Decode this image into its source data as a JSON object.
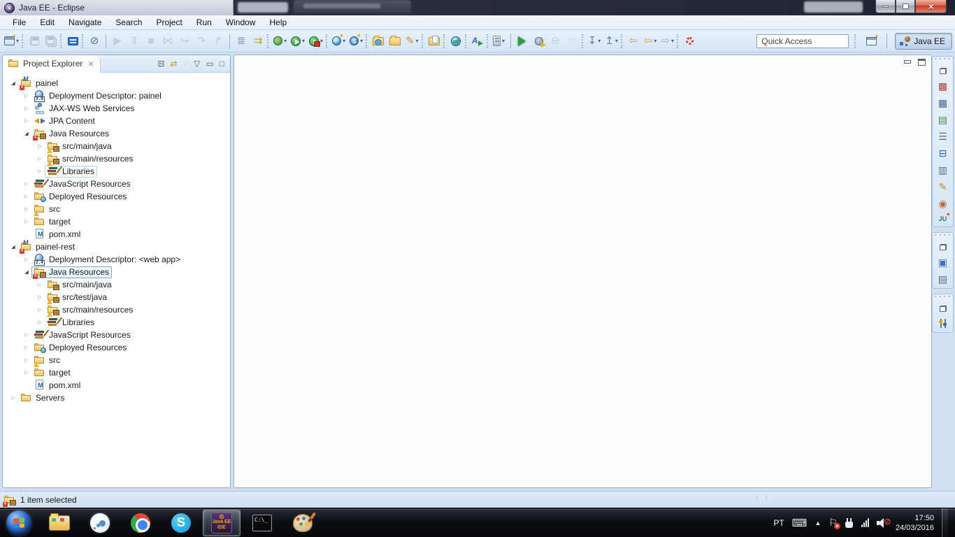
{
  "window": {
    "title": "Java EE - Eclipse",
    "controls": [
      {
        "name": "minimize-button"
      },
      {
        "name": "restore-button"
      },
      {
        "name": "close-button",
        "glyph": "×"
      }
    ]
  },
  "menu_bar": {
    "items": [
      "File",
      "Edit",
      "Navigate",
      "Search",
      "Project",
      "Run",
      "Window",
      "Help"
    ]
  },
  "toolbar": {
    "quick_access_placeholder": "Quick Access",
    "perspective_label": "Java EE",
    "open_perspective_icon": "open-perspective-icon",
    "groups": [
      {
        "sep": "none",
        "icons": [
          {
            "n": "new-wizard-icon",
            "t": "css",
            "c": "tb-new",
            "dd": true
          }
        ]
      },
      {
        "sep": "dot",
        "icons": [
          {
            "n": "save-icon",
            "t": "css",
            "c": "tb-floppy",
            "dis": true
          },
          {
            "n": "save-all-icon",
            "t": "css",
            "c": "tb-floppy tb-floppy-all",
            "dis": true
          }
        ]
      },
      {
        "sep": "dot",
        "icons": [
          {
            "n": "open-console-icon",
            "t": "css",
            "c": "tb-console"
          }
        ]
      },
      {
        "sep": "dot",
        "icons": [
          {
            "n": "skip-all-breakpoints-icon",
            "t": "g",
            "g": "⊘",
            "col": "#4a6fa0"
          }
        ]
      },
      {
        "sep": "bar",
        "icons": [
          {
            "n": "resume-icon",
            "t": "g",
            "g": "▶",
            "col": "#a4b2c2",
            "dis": true
          },
          {
            "n": "suspend-icon",
            "t": "g",
            "g": "Ⅱ",
            "col": "#a4b2c2",
            "dis": true
          },
          {
            "n": "terminate-icon",
            "t": "g",
            "g": "■",
            "col": "#a4b2c2",
            "dis": true
          },
          {
            "n": "disconnect-icon",
            "t": "g",
            "g": "⋈",
            "col": "#a4b2c2",
            "dis": true
          },
          {
            "n": "step-into-icon",
            "t": "g",
            "g": "↪",
            "col": "#a4b2c2",
            "dis": true
          },
          {
            "n": "step-over-icon",
            "t": "g",
            "g": "↷",
            "col": "#a4b2c2",
            "dis": true
          },
          {
            "n": "step-return-icon",
            "t": "g",
            "g": "↱",
            "col": "#a4b2c2",
            "dis": true
          }
        ]
      },
      {
        "sep": "bar",
        "icons": [
          {
            "n": "run-history-icon",
            "t": "g",
            "g": "≣",
            "col": "#8a97a8"
          },
          {
            "n": "use-step-filters-icon",
            "t": "g",
            "g": "⇉",
            "col": "#d0a030"
          }
        ]
      },
      {
        "sep": "dot",
        "icons": [
          {
            "n": "debug-icon",
            "t": "css",
            "c": "tb-bug",
            "dd": true
          },
          {
            "n": "run-icon",
            "t": "css",
            "c": "tb-run",
            "dd": true
          },
          {
            "n": "run-coverage-icon",
            "t": "css",
            "c": "tb-run tb-runc",
            "dd": true
          }
        ]
      },
      {
        "sep": "dot",
        "icons": [
          {
            "n": "new-web-service-icon",
            "t": "css",
            "c": "tb-wsglobe",
            "dd": true
          },
          {
            "n": "new-web-service-client-icon",
            "t": "css",
            "c": "tb-sglobe",
            "g": "S",
            "dd": true
          }
        ]
      },
      {
        "sep": "dot",
        "icons": [
          {
            "n": "import-folder-icon",
            "t": "css",
            "c": "tb-folder-open"
          },
          {
            "n": "export-folder-icon",
            "t": "css",
            "c": "tb-folder"
          },
          {
            "n": "highlighter-pen-icon",
            "t": "g",
            "g": "✎",
            "col": "#d08a2a",
            "dd": true
          }
        ]
      },
      {
        "sep": "dot",
        "icons": [
          {
            "n": "deploy-folder-icon",
            "t": "css",
            "c": "tb-folder-page"
          }
        ]
      },
      {
        "sep": "dot",
        "icons": [
          {
            "n": "web-browser-icon",
            "t": "css",
            "c": "tb-globe"
          }
        ]
      },
      {
        "sep": "dot",
        "icons": [
          {
            "n": "external-tools-icon",
            "t": "css",
            "c": "tb-ext"
          }
        ]
      },
      {
        "sep": "dot",
        "icons": [
          {
            "n": "servers-dropdown-icon",
            "t": "css",
            "c": "tb-server",
            "dd": true
          }
        ]
      },
      {
        "sep": "bar",
        "icons": [
          {
            "n": "run-app-icon",
            "t": "css",
            "c": "tb-play"
          },
          {
            "n": "debug-config-icon",
            "t": "css",
            "c": "tb-bug2"
          },
          {
            "n": "stop-app-icon",
            "t": "g",
            "g": "⊖",
            "col": "#a4b2c2",
            "dis": true
          },
          {
            "n": "pointer-mode-icon",
            "t": "g",
            "g": "☞",
            "col": "#a4b2c2",
            "dis": true
          }
        ]
      },
      {
        "sep": "dot",
        "icons": [
          {
            "n": "next-annotation-icon",
            "t": "g",
            "g": "↧",
            "col": "#6b7f95",
            "dd": true
          },
          {
            "n": "previous-annotation-icon",
            "t": "g",
            "g": "↥",
            "col": "#6b7f95",
            "dd": true
          }
        ]
      },
      {
        "sep": "dot",
        "icons": [
          {
            "n": "last-edit-location-icon",
            "t": "g",
            "g": "⇦",
            "col": "#d0a030"
          },
          {
            "n": "back-icon",
            "t": "g",
            "g": "⇦",
            "col": "#d0a030",
            "dd": true
          },
          {
            "n": "forward-icon",
            "t": "g",
            "g": "⇨",
            "col": "#a4b2c2",
            "dd": true
          }
        ]
      },
      {
        "sep": "dot",
        "icons": [
          {
            "n": "progress-indicator-icon",
            "t": "css",
            "c": "tb-busyc"
          }
        ]
      }
    ]
  },
  "project_explorer": {
    "title": "Project Explorer",
    "tab_close_glyph": "✕",
    "tools": [
      {
        "n": "collapse-all-icon",
        "g": "⊟"
      },
      {
        "n": "link-with-editor-icon",
        "g": "⇄",
        "col": "#c9972c"
      },
      {
        "n": "focus-task-icon",
        "g": "∵",
        "col": "#b8c4d2"
      },
      {
        "n": "view-menu-icon",
        "g": "▽"
      },
      {
        "n": "minimize-view-icon",
        "g": "▭"
      },
      {
        "n": "maximize-view-icon",
        "g": "□"
      }
    ],
    "tree": [
      {
        "label": "painel",
        "depth": 0,
        "arrow": "expanded",
        "icon": "mproj",
        "badge": "error"
      },
      {
        "label": "Deployment Descriptor: painel",
        "depth": 1,
        "arrow": "collapsed",
        "icon": "dd",
        "version": "3.0"
      },
      {
        "label": "JAX-WS Web Services",
        "depth": 1,
        "arrow": "collapsed",
        "icon": "jaxws"
      },
      {
        "label": "JPA Content",
        "depth": 1,
        "arrow": "collapsed",
        "icon": "jpa"
      },
      {
        "label": "Java Resources",
        "depth": 1,
        "arrow": "expanded",
        "icon": "jres",
        "badge": "error"
      },
      {
        "label": "src/main/java",
        "depth": 2,
        "arrow": "collapsed",
        "icon": "pkg",
        "badge": "warning"
      },
      {
        "label": "src/main/resources",
        "depth": 2,
        "arrow": "collapsed",
        "icon": "pkg",
        "badge": "warning"
      },
      {
        "label": "Libraries",
        "depth": 2,
        "arrow": "collapsed",
        "icon": "books",
        "focusbox": true
      },
      {
        "label": "JavaScript Resources",
        "depth": 1,
        "arrow": "collapsed",
        "icon": "books"
      },
      {
        "label": "Deployed Resources",
        "depth": 1,
        "arrow": "collapsed",
        "icon": "dfold"
      },
      {
        "label": "src",
        "depth": 1,
        "arrow": "collapsed",
        "icon": "fold",
        "badge": "warning"
      },
      {
        "label": "target",
        "depth": 1,
        "arrow": "collapsed",
        "icon": "fold"
      },
      {
        "label": "pom.xml",
        "depth": 1,
        "arrow": "none",
        "icon": "pom"
      },
      {
        "label": "painel-rest",
        "depth": 0,
        "arrow": "expanded",
        "icon": "mproj",
        "badge": "error"
      },
      {
        "label": "Deployment Descriptor: <web app>",
        "depth": 1,
        "arrow": "collapsed",
        "icon": "dd",
        "version": "2.4"
      },
      {
        "label": "Java Resources",
        "depth": 1,
        "arrow": "expanded",
        "icon": "jres",
        "badge": "error",
        "selected": true
      },
      {
        "label": "src/main/java",
        "depth": 2,
        "arrow": "collapsed",
        "icon": "pkg"
      },
      {
        "label": "src/test/java",
        "depth": 2,
        "arrow": "collapsed",
        "icon": "pkg",
        "badge": "warning"
      },
      {
        "label": "src/main/resources",
        "depth": 2,
        "arrow": "collapsed",
        "icon": "pkg",
        "badge": "warning"
      },
      {
        "label": "Libraries",
        "depth": 2,
        "arrow": "collapsed",
        "icon": "books"
      },
      {
        "label": "JavaScript Resources",
        "depth": 1,
        "arrow": "collapsed",
        "icon": "books"
      },
      {
        "label": "Deployed Resources",
        "depth": 1,
        "arrow": "collapsed",
        "icon": "dfold"
      },
      {
        "label": "src",
        "depth": 1,
        "arrow": "collapsed",
        "icon": "fold",
        "badge": "warning"
      },
      {
        "label": "target",
        "depth": 1,
        "arrow": "collapsed",
        "icon": "fold"
      },
      {
        "label": "pom.xml",
        "depth": 1,
        "arrow": "none",
        "icon": "pom"
      },
      {
        "label": "Servers",
        "depth": 0,
        "arrow": "collapsed",
        "icon": "fold"
      }
    ]
  },
  "right_rail": {
    "groups": [
      {
        "icons": [
          {
            "n": "view-restore-icon",
            "t": "css",
            "c": "ri-restore"
          },
          {
            "n": "markers-icon",
            "t": "g",
            "g": "▩",
            "col": "#b5443c"
          },
          {
            "n": "properties-icon",
            "t": "g",
            "g": "▦",
            "col": "#44639a"
          },
          {
            "n": "palette-icon",
            "t": "g",
            "g": "▤",
            "col": "#3d8f46"
          },
          {
            "n": "outline-icon",
            "t": "g",
            "g": "☰",
            "col": "#5a6a7e"
          },
          {
            "n": "console-icon",
            "t": "g",
            "g": "⊟",
            "col": "#2e62b8"
          },
          {
            "n": "servers-view-icon",
            "t": "g",
            "g": "▥",
            "col": "#57727f"
          },
          {
            "n": "snippets-icon",
            "t": "g",
            "g": "✎",
            "col": "#c8862a"
          },
          {
            "n": "palette-dots-icon",
            "t": "g",
            "g": "◉",
            "col": "#c06a32"
          },
          {
            "n": "junit-icon",
            "t": "css",
            "c": "ri-junit",
            "g": "JU"
          }
        ]
      },
      {
        "icons": [
          {
            "n": "view-restore-icon",
            "t": "css",
            "c": "ri-restore"
          },
          {
            "n": "outline-diagram-icon",
            "t": "g",
            "g": "▣",
            "col": "#3a6fc4"
          },
          {
            "n": "document-icon",
            "t": "g",
            "g": "▤",
            "col": "#5a6a7e"
          }
        ]
      },
      {
        "icons": [
          {
            "n": "view-restore-icon",
            "t": "css",
            "c": "ri-restore"
          },
          {
            "n": "synchronize-icon",
            "t": "css",
            "c": "ri-sliders"
          }
        ]
      }
    ]
  },
  "editor": {
    "controls": [
      {
        "n": "editor-minimize-icon"
      },
      {
        "n": "editor-maximize-icon"
      }
    ]
  },
  "status_bar": {
    "text": "1 item selected"
  },
  "taskbar": {
    "apps": [
      {
        "n": "windows-explorer-app",
        "c": "ai-exp"
      },
      {
        "n": "messenger-app",
        "c": "ai-msg"
      },
      {
        "n": "chrome-app",
        "c": "ai-chrome"
      },
      {
        "n": "skype-app",
        "c": "ai-skype",
        "g": "S"
      },
      {
        "n": "eclipse-javaee-app",
        "c": "ai-eclipse",
        "active": true,
        "lines": [
          "Java EE",
          "IDE"
        ]
      },
      {
        "n": "command-prompt-app",
        "c": "ai-cmd",
        "g": "C:\\_"
      },
      {
        "n": "paint-app",
        "c": "ai-paint"
      }
    ],
    "tray": {
      "language": "PT",
      "time": "17:50",
      "date": "24/03/2016",
      "icons": [
        {
          "n": "keyboard-icon",
          "t": "g",
          "c": "tray-kbd",
          "g": "⌨"
        },
        {
          "n": "hidden-icons-arrow",
          "t": "g",
          "c": "tray-up",
          "g": "▲"
        },
        {
          "n": "action-center-flag-icon",
          "t": "css",
          "c": "tr-flag",
          "g": "⚐"
        },
        {
          "n": "power-plug-icon",
          "t": "css",
          "c": "tr-plug"
        },
        {
          "n": "network-signal-icon",
          "t": "bars",
          "c": "tr-net"
        },
        {
          "n": "volume-muted-icon",
          "t": "vol",
          "c": "tr-vol"
        }
      ]
    }
  }
}
